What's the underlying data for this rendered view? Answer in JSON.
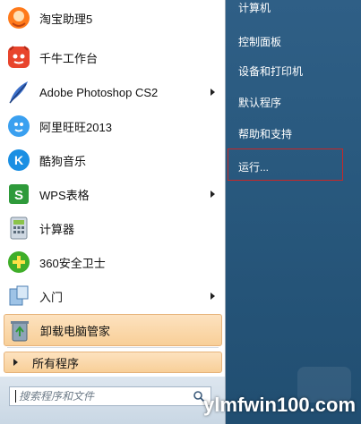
{
  "programs": [
    {
      "name": "淘宝助理5",
      "icon": "taobao-assistant-icon",
      "has_submenu": false
    },
    {
      "name": "千牛工作台",
      "icon": "qianniu-icon",
      "has_submenu": false
    },
    {
      "name": "Adobe Photoshop CS2",
      "icon": "photoshop-feather-icon",
      "has_submenu": true
    },
    {
      "name": "阿里旺旺2013",
      "icon": "aliwangwang-icon",
      "has_submenu": false
    },
    {
      "name": "酷狗音乐",
      "icon": "kugou-icon",
      "has_submenu": false
    },
    {
      "name": "WPS表格",
      "icon": "wps-sheet-icon",
      "has_submenu": true
    },
    {
      "name": "计算器",
      "icon": "calculator-icon",
      "has_submenu": false
    },
    {
      "name": "360安全卫士",
      "icon": "360-safe-icon",
      "has_submenu": false
    },
    {
      "name": "入门",
      "icon": "getting-started-icon",
      "has_submenu": true
    },
    {
      "name": "卸载电脑管家",
      "icon": "recycle-uninstall-icon",
      "has_submenu": false,
      "highlighted": true
    }
  ],
  "all_programs": "所有程序",
  "search": {
    "placeholder": "搜索程序和文件"
  },
  "places": [
    {
      "label": "计算机"
    },
    {
      "label": "控制面板"
    },
    {
      "label": "设备和打印机"
    },
    {
      "label": "默认程序"
    },
    {
      "label": "帮助和支持"
    },
    {
      "label": "运行...",
      "highlighted_box": true
    }
  ],
  "watermark": "ylmfwin100.com",
  "colors": {
    "right_pane": "#28587d",
    "highlight": "#f8cf98",
    "run_box_border": "#c62828"
  }
}
